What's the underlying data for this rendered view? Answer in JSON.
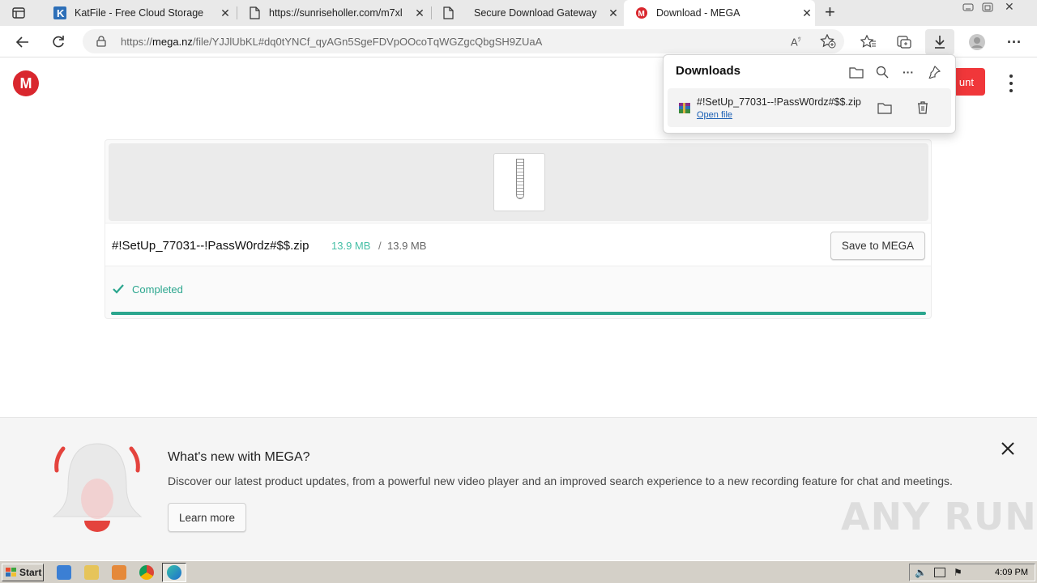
{
  "browser": {
    "tabs": [
      {
        "title": "KatFile - Free Cloud Storage",
        "favicon": "katfile-k-icon"
      },
      {
        "title": "https://sunriseholler.com/m7xl",
        "favicon": "page-icon"
      },
      {
        "title": "Secure Download Gateway",
        "favicon": "page-icon"
      },
      {
        "title": "Download - MEGA",
        "favicon": "mega-icon",
        "active": true
      }
    ],
    "url_prefix": "https://",
    "url_host": "mega.nz",
    "url_rest": "/file/YJJlUbKL#dq0tYNCf_qyAGn5SgeFDVpOOcoTqWGZgcQbgSH9ZUaA"
  },
  "downloads_panel": {
    "title": "Downloads",
    "item": {
      "filename": "#!SetUp_77031--!PassW0rdz#$$.zip",
      "open_label": "Open file"
    }
  },
  "mega": {
    "logo_letter": "M",
    "account_button": "unt",
    "file": {
      "name": "#!SetUp_77031--!PassW0rdz#$$.zip",
      "downloaded": "13.9 MB",
      "separator": "/",
      "total": "13.9 MB",
      "save_button": "Save to MEGA",
      "status": "Completed",
      "progress_fraction": 1.0
    },
    "promo": {
      "title": "What's new with MEGA?",
      "description": "Discover our latest product updates, from a powerful new video player and an improved search experience to a new recording feature for chat and meetings.",
      "button": "Learn more"
    }
  },
  "watermark": "ANY RUN",
  "taskbar": {
    "start_label": "Start",
    "clock": "4:09 PM"
  },
  "colors": {
    "mega_red": "#d9272e",
    "success_green": "#2ba68e",
    "size_green": "#46bfa6"
  }
}
